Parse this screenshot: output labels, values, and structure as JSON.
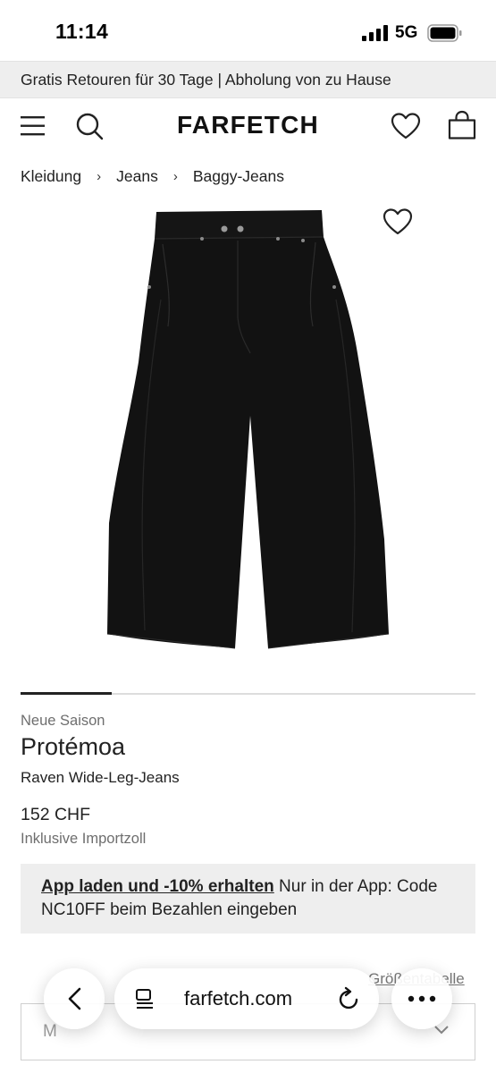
{
  "status_bar": {
    "time": "11:14",
    "network": "5G",
    "icons": [
      "signal-icon",
      "battery-icon"
    ]
  },
  "promo_banner": {
    "text": "Gratis Retouren für 30 Tage | Abholung von zu Hause"
  },
  "header": {
    "brand": "FARFETCH",
    "icons": [
      "menu-icon",
      "search-icon",
      "heart-icon",
      "shopping-bag-icon"
    ]
  },
  "breadcrumb": {
    "items": [
      "Kleidung",
      "Jeans",
      "Baggy-Jeans"
    ],
    "separator": "›"
  },
  "product": {
    "image_alt_icon": "wide-leg-jeans-image",
    "carousel": {
      "current": 1,
      "total": 5
    },
    "season": "Neue Saison",
    "brand": "Protémoa",
    "name": "Raven Wide-Leg-Jeans",
    "price": "152 CHF",
    "price_note": "Inklusive Importzoll"
  },
  "app_promo": {
    "link_text": "App laden und -10% erhalten",
    "text": " Nur in der App: Code NC10FF beim Bezahlen eingeben"
  },
  "size": {
    "guide_label": "Größentabelle",
    "selected": "M"
  },
  "browser": {
    "url": "farfetch.com",
    "icons": [
      "back-icon",
      "reader-icon",
      "reload-icon",
      "more-icon"
    ]
  },
  "colors": {
    "banner_bg": "#eeeeee",
    "text": "#222222",
    "muted": "#6e6e6e"
  }
}
